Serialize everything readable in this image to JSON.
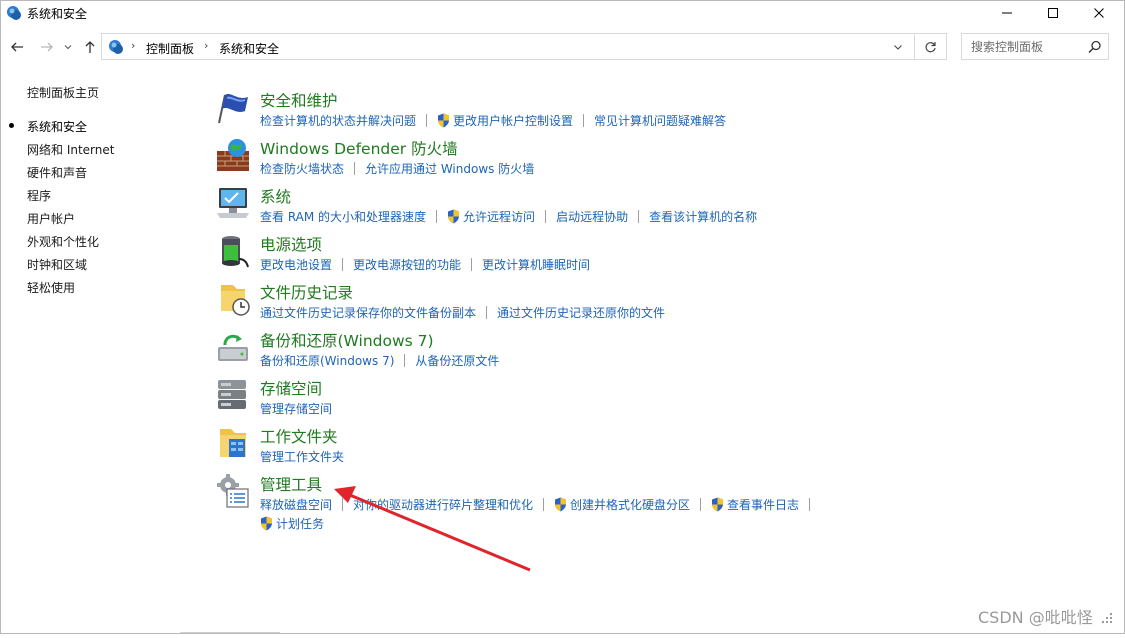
{
  "window": {
    "title": "系统和安全",
    "minimize_icon": "minimize-icon",
    "maximize_icon": "maximize-icon",
    "close_icon": "close-icon"
  },
  "address_bar": {
    "breadcrumbs": [
      "控制面板",
      "系统和安全"
    ],
    "search_placeholder": "搜索控制面板"
  },
  "sidebar": {
    "items": [
      {
        "label": "控制面板主页",
        "current": false
      },
      {
        "label": "系统和安全",
        "current": true
      },
      {
        "label": "网络和 Internet",
        "current": false
      },
      {
        "label": "硬件和声音",
        "current": false
      },
      {
        "label": "程序",
        "current": false
      },
      {
        "label": "用户帐户",
        "current": false
      },
      {
        "label": "外观和个性化",
        "current": false
      },
      {
        "label": "时钟和区域",
        "current": false
      },
      {
        "label": "轻松使用",
        "current": false
      }
    ]
  },
  "categories": [
    {
      "name": "安全和维护",
      "icon": "flag-icon",
      "links": [
        "检查计算机的状态并解决问题",
        "更改用户帐户控制设置",
        "常见计算机问题疑难解答"
      ]
    },
    {
      "name": "Windows Defender 防火墙",
      "icon": "firewall-icon",
      "links": [
        "检查防火墙状态",
        "允许应用通过 Windows 防火墙"
      ]
    },
    {
      "name": "系统",
      "icon": "computer-icon",
      "links": [
        "查看 RAM 的大小和处理器速度",
        "允许远程访问",
        "启动远程协助",
        "查看该计算机的名称"
      ]
    },
    {
      "name": "电源选项",
      "icon": "battery-icon",
      "links": [
        "更改电池设置",
        "更改电源按钮的功能",
        "更改计算机睡眠时间"
      ]
    },
    {
      "name": "文件历史记录",
      "icon": "file-history-icon",
      "links": [
        "通过文件历史记录保存你的文件备份副本",
        "通过文件历史记录还原你的文件"
      ]
    },
    {
      "name": "备份和还原(Windows 7)",
      "icon": "backup-icon",
      "links": [
        "备份和还原(Windows 7)",
        "从备份还原文件"
      ]
    },
    {
      "name": "存储空间",
      "icon": "storage-icon",
      "links": [
        "管理存储空间"
      ]
    },
    {
      "name": "工作文件夹",
      "icon": "work-folders-icon",
      "links": [
        "管理工作文件夹"
      ]
    },
    {
      "name": "管理工具",
      "icon": "admin-tools-icon",
      "links": [
        "释放磁盘空间",
        "对你的驱动器进行碎片整理和优化",
        "创建并格式化硬盘分区",
        "查看事件日志",
        "计划任务"
      ]
    }
  ],
  "annotation": {
    "arrow_color": "#e0242b"
  },
  "watermark": "CSDN @吡吡怪",
  "colors": {
    "category_title": "#207a20",
    "link": "#1e64b4"
  }
}
